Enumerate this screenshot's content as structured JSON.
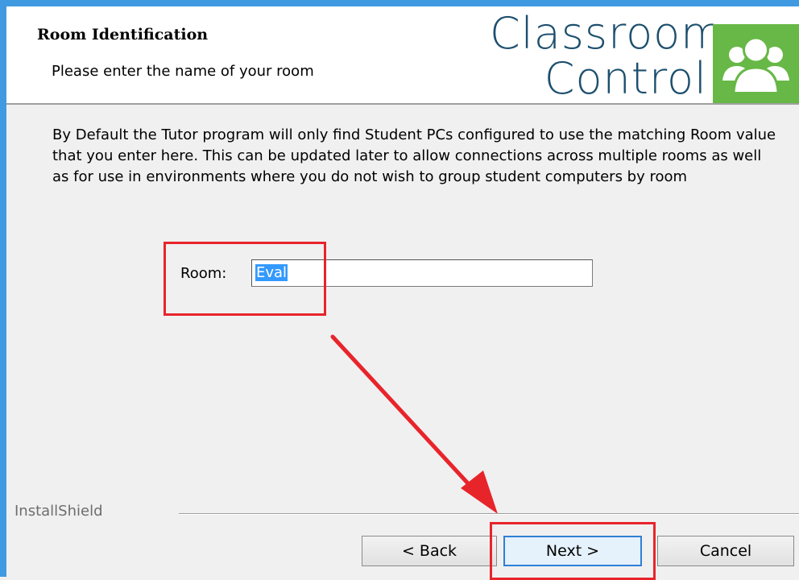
{
  "header": {
    "title": "Room Identification",
    "subtitle": "Please enter the name of your room",
    "logo_line1": "Classroom",
    "logo_line2": "Control",
    "logo_icon": "users-group-icon"
  },
  "body": {
    "description": "By Default the Tutor program will only find Student PCs configured to use the matching Room value that you enter here. This can be updated later to allow connections across multiple rooms as well as for use in environments where you do not wish to group student computers by room"
  },
  "room": {
    "label": "Room:",
    "value": "Eval"
  },
  "footer": {
    "brand": "InstallShield",
    "back_label": "< Back",
    "next_label": "Next >",
    "cancel_label": "Cancel"
  },
  "colors": {
    "frame": "#3f9ae2",
    "logo_text": "#1c4f6e",
    "logo_green": "#67b846",
    "annotation": "#e8242b",
    "selection": "#3399ff"
  }
}
